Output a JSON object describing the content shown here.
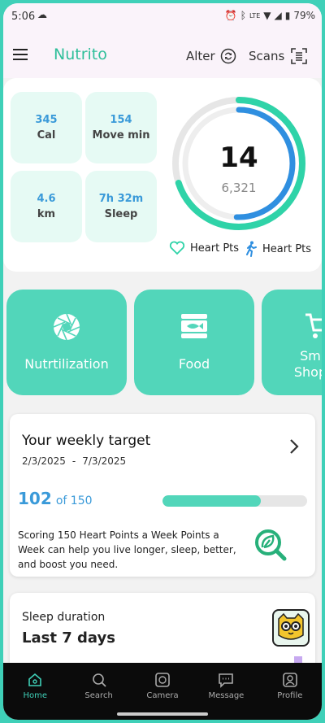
{
  "status_bar": {
    "time": "5:06",
    "battery": "79%",
    "network": "LTE"
  },
  "app_bar": {
    "brand": "Nutrito",
    "alter_label": "Alter",
    "scans_label": "Scans"
  },
  "summary": {
    "stats": [
      {
        "value": "345",
        "label": "Cal"
      },
      {
        "value": "154",
        "label": "Move min"
      },
      {
        "value": "4.6",
        "label": "km"
      },
      {
        "value": "7h 32m",
        "label": "Sleep"
      }
    ],
    "ring_value": "14",
    "ring_sub": "6,321",
    "legend_heart": "Heart Pts",
    "legend_walk": "Heart Pts",
    "colors": {
      "outer": "#2fd3a8",
      "inner": "#2f8fe0",
      "track": "#e6e6e6"
    }
  },
  "tiles": [
    {
      "label": "Nutrtilization",
      "icon": "camera-shutter-icon"
    },
    {
      "label": "Food",
      "icon": "fish-food-icon"
    },
    {
      "label": "Sm Shop",
      "icon": "shopping-cart-icon"
    }
  ],
  "weekly": {
    "title": "Your weekly target",
    "date_start": "2/3/2025",
    "date_sep": "-",
    "date_end": "7/3/2025",
    "score": "102",
    "score_of": "of 150",
    "progress": 0.68,
    "description": "Scoring 150 Heart Points a Week Points a Week can help you live longer, sleep, better, and boost you need."
  },
  "sleep": {
    "title": "Sleep duration",
    "subtitle": "Last 7 days"
  },
  "navbar": {
    "items": [
      {
        "label": "Home",
        "icon": "home-icon"
      },
      {
        "label": "Search",
        "icon": "search-icon"
      },
      {
        "label": "Camera",
        "icon": "camera-icon"
      },
      {
        "label": "Message",
        "icon": "message-icon"
      },
      {
        "label": "Profile",
        "icon": "profile-icon"
      }
    ]
  }
}
